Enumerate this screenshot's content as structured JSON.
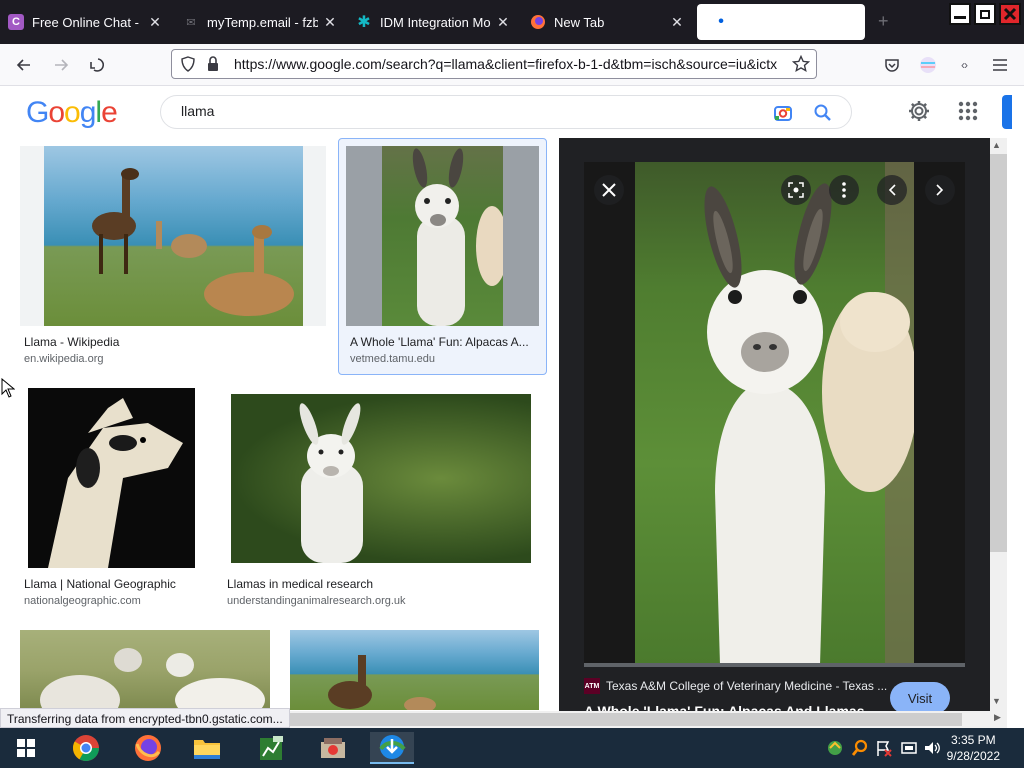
{
  "tabs": [
    {
      "title": "Free Online Chat - Me",
      "icon": "chat-logo-icon",
      "icon_glyph": "C",
      "icon_color": "#a259c4"
    },
    {
      "title": "myTemp.email - fzbo",
      "icon": "mail-icon",
      "icon_glyph": "✉",
      "icon_color": "#6e6e75"
    },
    {
      "title": "IDM Integration Modu",
      "icon": "puzzle-icon",
      "icon_glyph": "✱",
      "icon_color": "#14b8c4"
    },
    {
      "title": "New Tab",
      "icon": "firefox-icon",
      "icon_glyph": "",
      "icon_color": "#ff7139"
    },
    {
      "title": "",
      "icon": "loading-icon",
      "icon_glyph": "•",
      "icon_color": "#0060df"
    }
  ],
  "address": {
    "url": "https://www.google.com/search?q=llama&client=firefox-b-1-d&tbm=isch&source=iu&ictx"
  },
  "search": {
    "query": "llama"
  },
  "results": [
    {
      "caption": "Llama - Wikipedia",
      "source": "en.wikipedia.org"
    },
    {
      "caption": "A Whole 'Llama' Fun: Alpacas A...",
      "source": "vetmed.tamu.edu"
    },
    {
      "caption": "Llama | National Geographic",
      "source": "nationalgeographic.com"
    },
    {
      "caption": "Llamas in medical research",
      "source": "understandinganimalresearch.org.uk"
    }
  ],
  "preview": {
    "site": "Texas A&M College of Veterinary Medicine - Texas ...",
    "site_logo": "ATM",
    "title": "A Whole 'Llama' Fun: Alpacas And Llamas",
    "visit_label": "Visit"
  },
  "status": {
    "text": "Transferring data from encrypted-tbn0.gstatic.com..."
  },
  "taskbar": {
    "time": "3:35 PM",
    "date": "9/28/2022"
  },
  "colors": {
    "accent": "#1a73e8",
    "tab_bar": "#1c1b22",
    "visit_button": "#8ab4f8"
  }
}
